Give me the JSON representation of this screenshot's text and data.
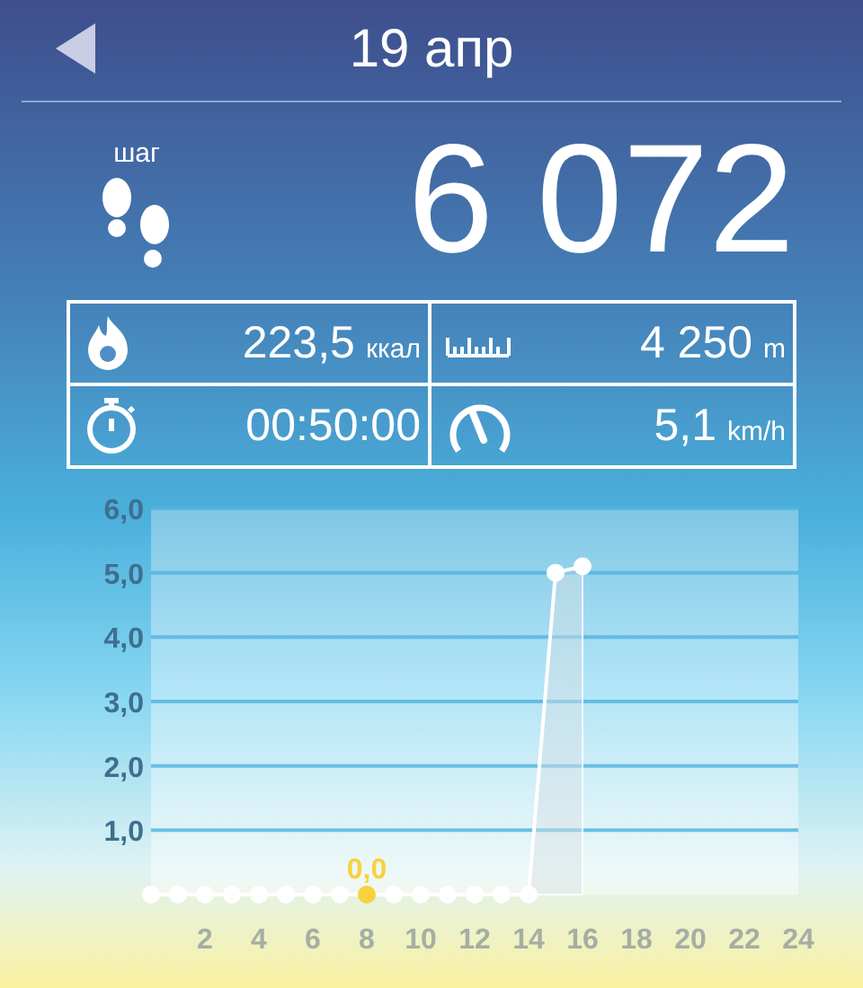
{
  "header": {
    "title": "19 апр"
  },
  "steps": {
    "label": "шаг",
    "value": "6 072"
  },
  "stats": [
    {
      "kind": "calories",
      "value": "223,5",
      "unit": "ккал"
    },
    {
      "kind": "distance",
      "value": "4 250",
      "unit": "m"
    },
    {
      "kind": "duration",
      "value": "00:50:00"
    },
    {
      "kind": "speed",
      "value": "5,1",
      "unit": "km/h"
    }
  ],
  "chart": {
    "chart_data": {
      "type": "area",
      "x": [
        0,
        1,
        2,
        3,
        4,
        5,
        6,
        7,
        8,
        9,
        10,
        11,
        12,
        13,
        14,
        15,
        16
      ],
      "series": [
        {
          "color": "#ffffff",
          "values": [
            0,
            0,
            0,
            0,
            0,
            0,
            0,
            0,
            0,
            0,
            0,
            0,
            0,
            0,
            0,
            5.0,
            5.1
          ]
        }
      ],
      "grid": true,
      "xlim": [
        0,
        24
      ],
      "ylim": [
        0,
        6
      ],
      "xticks": [
        2,
        4,
        6,
        8,
        10,
        12,
        14,
        16,
        18,
        20,
        22,
        24
      ],
      "yticks": [
        {
          "value": 1,
          "label": "1,0"
        },
        {
          "value": 2,
          "label": "2,0"
        },
        {
          "value": 3,
          "label": "3,0"
        },
        {
          "value": 4,
          "label": "4,0"
        },
        {
          "value": 5,
          "label": "5,0"
        },
        {
          "value": 6,
          "label": "6,0"
        }
      ],
      "annotations": [
        {
          "x": 8,
          "y": 0,
          "text": "0,0"
        }
      ]
    }
  }
}
